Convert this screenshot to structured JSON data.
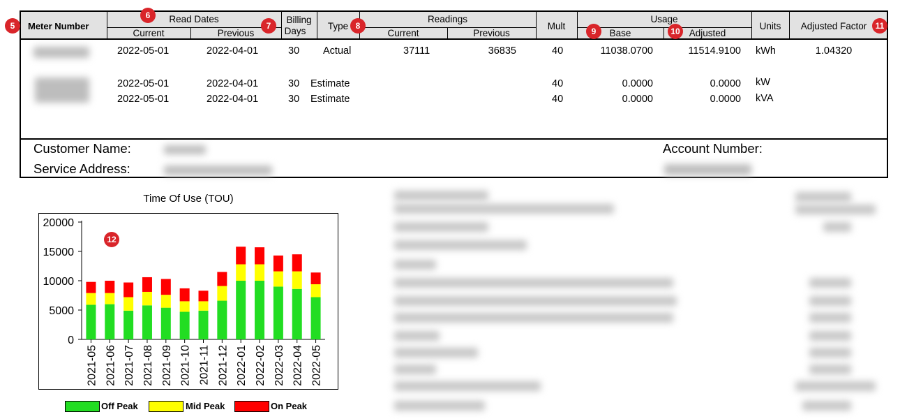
{
  "table": {
    "headers": {
      "meter_number": "Meter Number",
      "read_dates": "Read Dates",
      "current": "Current",
      "previous": "Previous",
      "billing": "Billing",
      "days": "Days",
      "type": "Type",
      "readings": "Readings",
      "readings_current": "Current",
      "readings_previous": "Previous",
      "mult": "Mult",
      "usage": "Usage",
      "base": "Base",
      "adjusted": "Adjusted",
      "units": "Units",
      "adjusted_factor": "Adjusted Factor"
    },
    "rows": [
      {
        "current": "2022-05-01",
        "previous": "2022-04-01",
        "days": "30",
        "type": "Actual",
        "read_cur": "37111",
        "read_prev": "36835",
        "mult": "40",
        "base": "11038.0700",
        "adjusted": "11514.9100",
        "units": "kWh",
        "factor": "1.04320"
      },
      {
        "current": "2022-05-01",
        "previous": "2022-04-01",
        "days": "30",
        "type": "Estimate",
        "read_cur": "",
        "read_prev": "",
        "mult": "40",
        "base": "0.0000",
        "adjusted": "0.0000",
        "units": "kW",
        "factor": ""
      },
      {
        "current": "2022-05-01",
        "previous": "2022-04-01",
        "days": "30",
        "type": "Estimate",
        "read_cur": "",
        "read_prev": "",
        "mult": "40",
        "base": "0.0000",
        "adjusted": "0.0000",
        "units": "kVA",
        "factor": ""
      }
    ]
  },
  "customer": {
    "name_label": "Customer Name:",
    "address_label": "Service Address:",
    "account_label": "Account Number:"
  },
  "badges": [
    "5",
    "6",
    "7",
    "8",
    "9",
    "10",
    "11",
    "12"
  ],
  "chart_data": {
    "type": "bar",
    "stacked": true,
    "title": "Time Of Use (TOU)",
    "categories": [
      "2021-05",
      "2021-06",
      "2021-07",
      "2021-08",
      "2021-09",
      "2021-10",
      "2021-11",
      "2021-12",
      "2022-01",
      "2022-02",
      "2022-03",
      "2022-04",
      "2022-05"
    ],
    "series": [
      {
        "name": "Off Peak",
        "color": "#22dd22",
        "values": [
          5900,
          6000,
          4900,
          5800,
          5400,
          4700,
          4900,
          6600,
          10000,
          10000,
          9000,
          8600,
          7200
        ]
      },
      {
        "name": "Mid Peak",
        "color": "#ffff00",
        "values": [
          2000,
          1900,
          2300,
          2300,
          2200,
          1800,
          1600,
          2500,
          2800,
          2800,
          2600,
          3000,
          2200
        ]
      },
      {
        "name": "On Peak",
        "color": "#ff0000",
        "values": [
          1900,
          2100,
          2500,
          2500,
          2700,
          2200,
          1800,
          2400,
          3000,
          2900,
          2700,
          2900,
          2000
        ]
      }
    ],
    "yticks": [
      0,
      5000,
      10000,
      15000,
      20000
    ],
    "ylim": [
      0,
      20000
    ],
    "legend": "bottom"
  }
}
